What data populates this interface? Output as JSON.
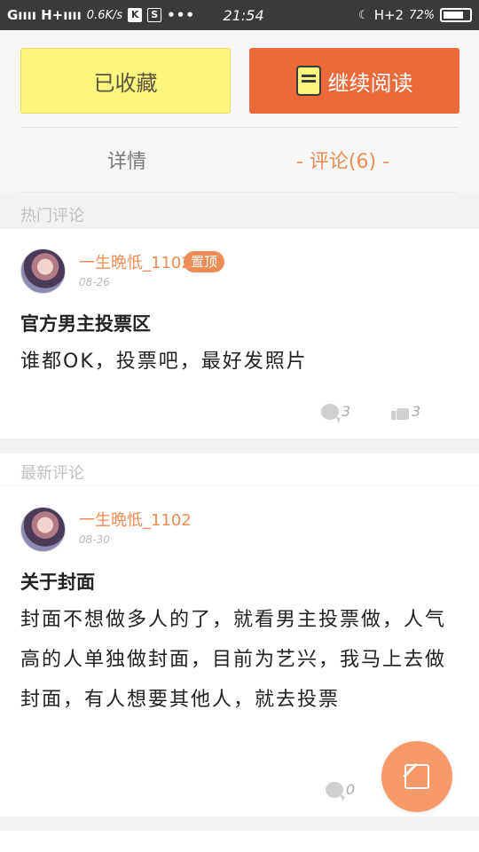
{
  "status_bar": {
    "signal": "Gıııı H+ıııı",
    "speed": "0.6K/s",
    "icon_k": "K",
    "icon_s": "S",
    "dots": "•••",
    "time": "21:54",
    "network": "H+2",
    "battery_text": "72%",
    "battery_level": 0.72
  },
  "actions": {
    "favorited_label": "已收藏",
    "continue_label": "继续阅读"
  },
  "tabs": {
    "detail": "详情",
    "comments": "- 评论(6) -"
  },
  "hot": {
    "section_label": "热门评论",
    "comment": {
      "username": "一生晩忯_1102",
      "badge": "置顶",
      "date": "08-26",
      "title": "官方男主投票区",
      "body": "谁都OK，投票吧，最好发照片",
      "reply_count": "3",
      "like_count": "3"
    }
  },
  "latest": {
    "section_label": "最新评论",
    "comment": {
      "username": "一生晩忯_1102",
      "date": "08-30",
      "title": "关于封面",
      "body": "封面不想做多人的了，就看男主投票做，人气高的人单独做封面，目前为艺兴，我马上去做封面，有人想要其他人，就去投票",
      "reply_count": "0"
    }
  },
  "colors": {
    "accent": "#ee8c55",
    "favorite_bg": "#fdf57e",
    "continue_bg": "#ea6a3a",
    "fab_bg": "#f79a6a"
  },
  "icons": [
    "book-icon",
    "bubble-icon",
    "thumb-up-icon",
    "edit-icon",
    "battery-icon",
    "moon-icon"
  ]
}
